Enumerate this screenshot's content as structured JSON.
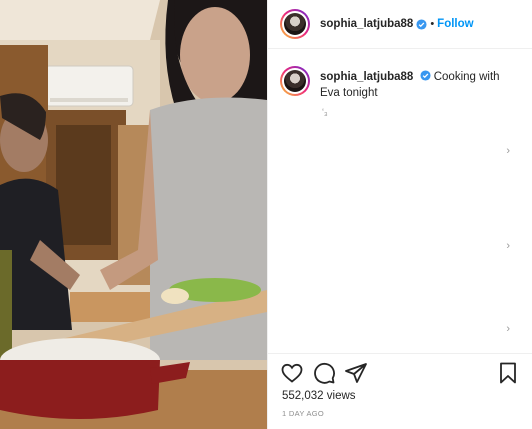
{
  "post": {
    "username": "sophia_latjuba88",
    "follow_label": "Follow",
    "separator": "•",
    "caption": "Cooking with Eva tonight",
    "reply_glyph": "ʻ₃",
    "views": "552,032 views",
    "timestamp": "1 DAY AGO"
  },
  "icons": {
    "verified": "verified-badge-icon",
    "like": "heart-icon",
    "comment": "comment-bubble-icon",
    "share": "paper-plane-icon",
    "save": "bookmark-icon"
  },
  "colors": {
    "follow": "#0095f6",
    "verified": "#3897f0",
    "muted": "#8e8e8e"
  }
}
